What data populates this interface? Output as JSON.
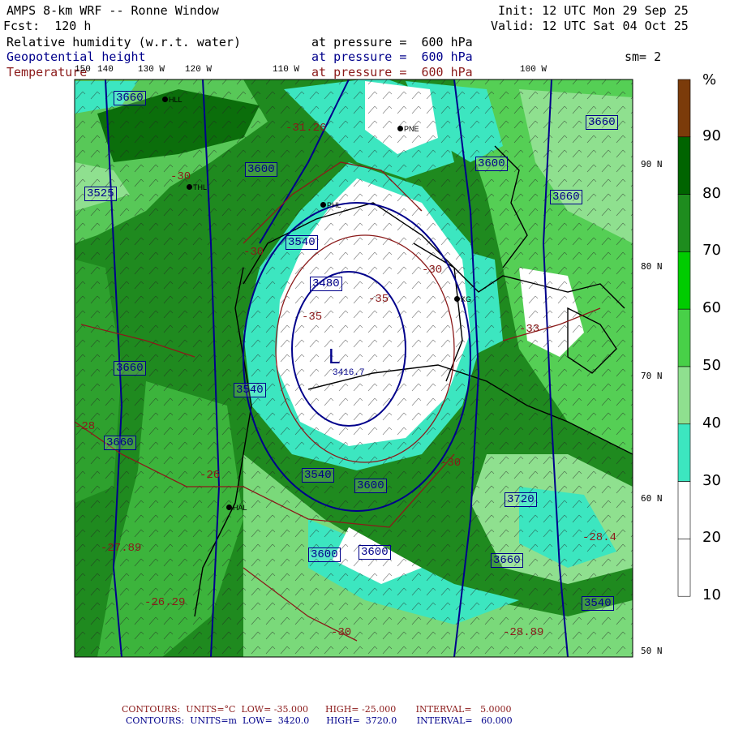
{
  "header": {
    "title": "AMPS 8-km WRF -- Ronne Window",
    "forecast": "Fcst:  120 h",
    "init": "Init: 12 UTC Mon 29 Sep 25",
    "valid": "Valid: 12 UTC Sat 04 Oct 25",
    "field1_name": "Relative humidity (w.r.t. water)",
    "field1_level": "at pressure =  600 hPa",
    "field2_name": "Geopotential height",
    "field2_level": "at pressure =  600 hPa",
    "field3_name": "Temperature",
    "field3_level": "at pressure =  600 hPa",
    "smoothing": "sm= 2"
  },
  "longitude_labels": [
    "150",
    "140",
    "130 W",
    "120 W",
    "110 W",
    "100 W"
  ],
  "latitude_labels": [
    "90 N",
    "80 N",
    "70 N",
    "60 N",
    "50 N"
  ],
  "station_labels": [
    "HLL",
    "THL",
    "PHL",
    "PNE",
    "KG",
    "HAL"
  ],
  "colorbar": {
    "unit": "%",
    "ticks": [
      "90",
      "80",
      "70",
      "60",
      "50",
      "40",
      "30",
      "20",
      "10"
    ],
    "colors": [
      "#7b3b0a",
      "#006400",
      "#1e8c1e",
      "#00cc00",
      "#48d048",
      "#8fe08f",
      "#3ce6c0",
      "#ffffff",
      "#ffffff"
    ]
  },
  "height_contour_labels": [
    "3660",
    "3660",
    "3600",
    "3600",
    "3540",
    "3480",
    "3540",
    "3540",
    "3600",
    "3600",
    "3660",
    "3660",
    "3660",
    "3720",
    "3540",
    "3600",
    "3660",
    "3525"
  ],
  "temperature_contour_labels": [
    "-31.26",
    "-30",
    "-30",
    "-35",
    "-35",
    "-30",
    "-30",
    "-28",
    "-26",
    "-27.89",
    "-26.29",
    "-28.4",
    "-28.89",
    "-30",
    "-33"
  ],
  "low_marker": "L",
  "low_value": "3416.7",
  "footer": {
    "temp_line": "CONTOURS:  UNITS=°C  LOW= -35.000      HIGH= -25.000       INTERVAL=   5.0000",
    "height_line": "CONTOURS:  UNITS=m  LOW=  3420.0      HIGH=  3720.0       INTERVAL=   60.000"
  }
}
